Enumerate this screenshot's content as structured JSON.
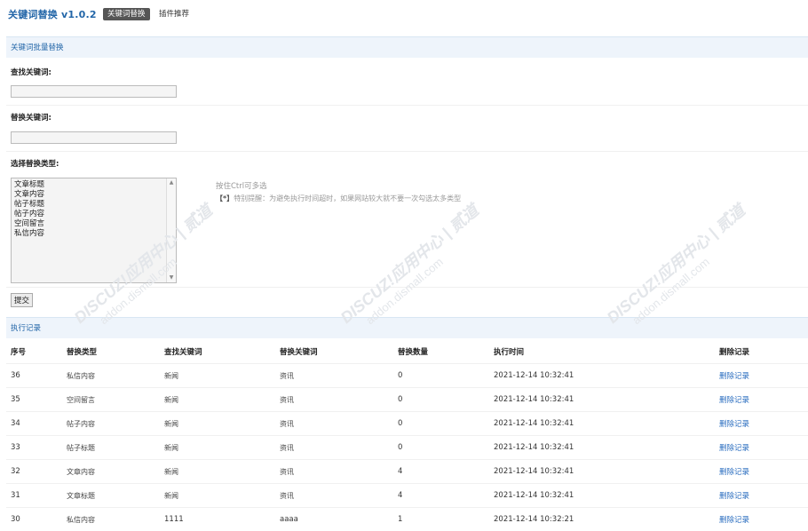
{
  "header": {
    "app_title": "关键词替换 v1.0.2",
    "tabs": [
      {
        "label": "关键词替换",
        "active": true
      },
      {
        "label": "插件推荐",
        "active": false
      }
    ]
  },
  "form": {
    "section_title": "关键词批量替换",
    "find_label": "查找关键词:",
    "find_value": "",
    "replace_label": "替换关键词:",
    "replace_value": "",
    "type_label": "选择替换类型:",
    "type_options": [
      "文章标题",
      "文章内容",
      "帖子标题",
      "帖子内容",
      "空间留言",
      "私信内容"
    ],
    "hint_ctrl": "按住Ctrl可多选",
    "hint_warning_prefix": "【*】",
    "hint_warning": "特别提醒：为避免执行时间超时，如果网站较大就不要一次勾选太多类型",
    "submit_label": "提交"
  },
  "records": {
    "section_title": "执行记录",
    "columns": [
      "序号",
      "替换类型",
      "查找关键词",
      "替换关键词",
      "替换数量",
      "执行时间",
      "删除记录"
    ],
    "rows": [
      {
        "id": "36",
        "type": "私信内容",
        "find": "新闻",
        "replace": "资讯",
        "count": "0",
        "time": "2021-12-14 10:32:41",
        "action": "删除记录"
      },
      {
        "id": "35",
        "type": "空间留言",
        "find": "新闻",
        "replace": "资讯",
        "count": "0",
        "time": "2021-12-14 10:32:41",
        "action": "删除记录"
      },
      {
        "id": "34",
        "type": "帖子内容",
        "find": "新闻",
        "replace": "资讯",
        "count": "0",
        "time": "2021-12-14 10:32:41",
        "action": "删除记录"
      },
      {
        "id": "33",
        "type": "帖子标题",
        "find": "新闻",
        "replace": "资讯",
        "count": "0",
        "time": "2021-12-14 10:32:41",
        "action": "删除记录"
      },
      {
        "id": "32",
        "type": "文章内容",
        "find": "新闻",
        "replace": "资讯",
        "count": "4",
        "time": "2021-12-14 10:32:41",
        "action": "删除记录"
      },
      {
        "id": "31",
        "type": "文章标题",
        "find": "新闻",
        "replace": "资讯",
        "count": "4",
        "time": "2021-12-14 10:32:41",
        "action": "删除记录"
      },
      {
        "id": "30",
        "type": "私信内容",
        "find": "1111",
        "replace": "aaaa",
        "count": "1",
        "time": "2021-12-14 10:32:21",
        "action": "删除记录"
      }
    ]
  },
  "watermark": {
    "line1": "DISCUZ!应用中心 | 贰道",
    "line2": "addon.dismall.com",
    "color": "#e3e6ea"
  },
  "colors": {
    "accent": "#2366a8",
    "section_bg": "#eef4fb",
    "link": "#2a6dbf"
  }
}
